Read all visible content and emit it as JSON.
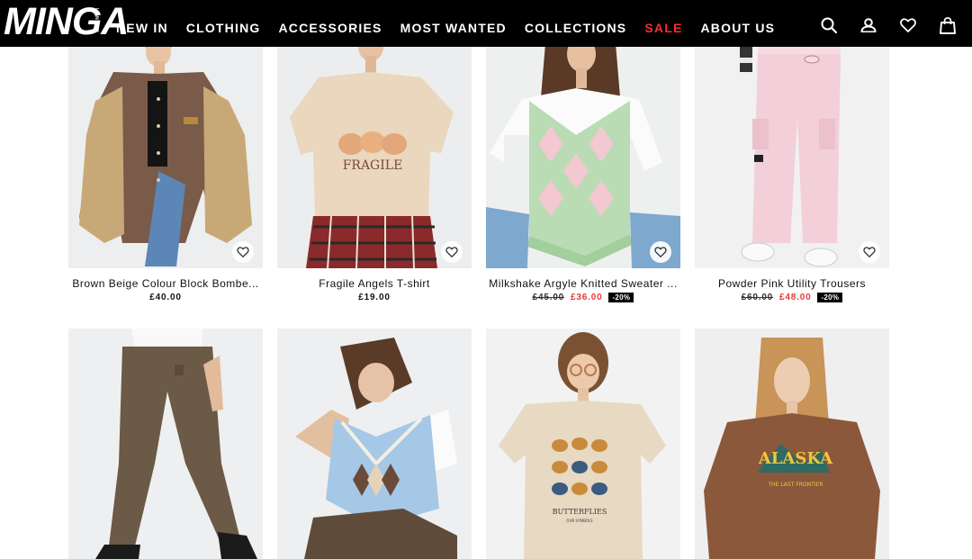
{
  "header": {
    "logo": "MINGA",
    "logo_sub": "LONDON",
    "nav": [
      {
        "label": "NEW IN"
      },
      {
        "label": "CLOTHING"
      },
      {
        "label": "ACCESSORIES"
      },
      {
        "label": "MOST WANTED"
      },
      {
        "label": "COLLECTIONS"
      },
      {
        "label": "SALE"
      },
      {
        "label": "ABOUT US"
      }
    ],
    "icons": [
      "search-icon",
      "account-icon",
      "wishlist-icon",
      "bag-icon"
    ]
  },
  "products": [
    {
      "name": "Brown Beige Colour Block Bombe...",
      "price": "£40.00"
    },
    {
      "name": "Fragile Angels T-shirt",
      "price": "£19.00",
      "print": "FRAGILE"
    },
    {
      "name": "Milkshake Argyle Knitted Sweater ...",
      "old_price": "£45.00",
      "price": "£36.00",
      "discount": "-20%"
    },
    {
      "name": "Powder Pink Utility Trousers",
      "old_price": "£60.00",
      "price": "£48.00",
      "discount": "-20%"
    },
    {
      "name": "",
      "price": ""
    },
    {
      "name": "",
      "price": ""
    },
    {
      "name": "",
      "price": "",
      "print": "BUTTERFLIES",
      "print_sub": "OUR SYMBOLS"
    },
    {
      "name": "",
      "price": "",
      "print": "ALASKA",
      "print_sub": "THE LAST FRONTIER"
    }
  ],
  "colors": {
    "header_bg": "#000000",
    "sale": "#ff2b2b",
    "discount_price": "#e53935"
  }
}
